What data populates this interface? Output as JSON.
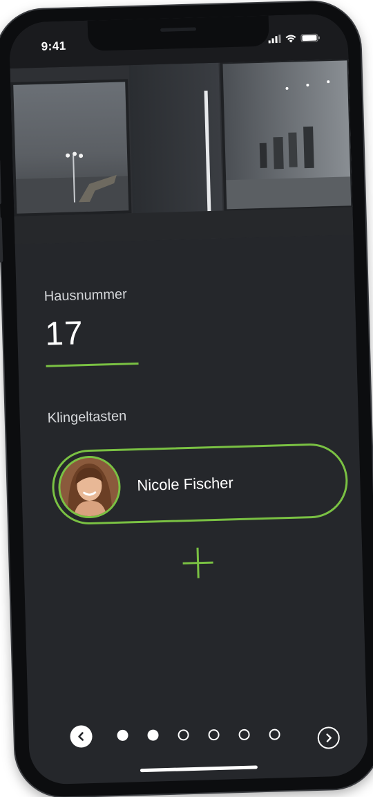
{
  "status_bar": {
    "time": "9:41",
    "icons": [
      "signal-icon",
      "wifi-icon",
      "battery-icon"
    ]
  },
  "house": {
    "label": "Hausnummer",
    "number": "17"
  },
  "bells": {
    "label": "Klingeltasten",
    "items": [
      {
        "name": "Nicole Fischer"
      }
    ],
    "add_icon": "plus-icon"
  },
  "pager": {
    "prev_icon": "chevron-left-icon",
    "next_icon": "chevron-right-icon",
    "dots": [
      "filled",
      "filled",
      "empty",
      "empty",
      "empty",
      "empty"
    ]
  },
  "colors": {
    "accent": "#7ac143",
    "background": "#25272b",
    "text": "#ffffff"
  }
}
